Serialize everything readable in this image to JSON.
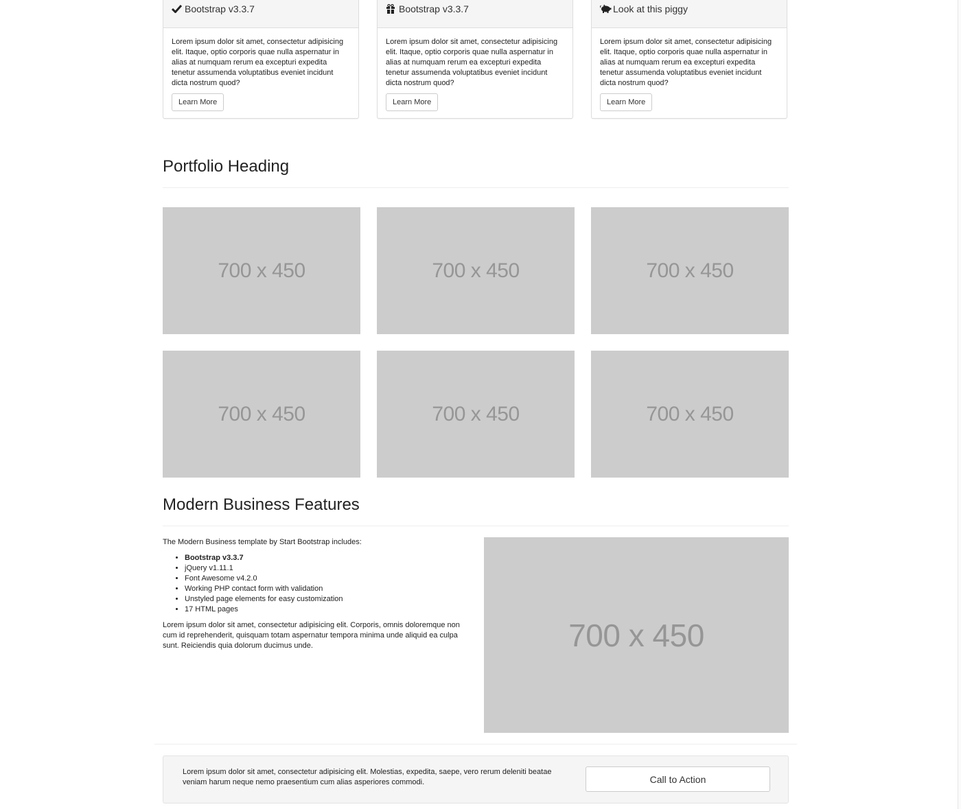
{
  "panels": [
    {
      "icon": "check-icon",
      "title": "Bootstrap v3.3.7",
      "text": "Lorem ipsum dolor sit amet, consectetur adipisicing elit. Itaque, optio corporis quae nulla aspernatur in alias at numquam rerum ea excepturi expedita tenetur assumenda voluptatibus eveniet incidunt dicta nostrum quod?",
      "button": "Learn More"
    },
    {
      "icon": "gift-icon",
      "title": "Bootstrap v3.3.7",
      "text": "Lorem ipsum dolor sit amet, consectetur adipisicing elit. Itaque, optio corporis quae nulla aspernatur in alias at numquam rerum ea excepturi expedita tenetur assumenda voluptatibus eveniet incidunt dicta nostrum quod?",
      "button": "Learn More"
    },
    {
      "icon": "piggy-bank-icon",
      "title": "Look at this piggy",
      "text": "Lorem ipsum dolor sit amet, consectetur adipisicing elit. Itaque, optio corporis quae nulla aspernatur in alias at numquam rerum ea excepturi expedita tenetur assumenda voluptatibus eveniet incidunt dicta nostrum quod?",
      "button": "Learn More"
    }
  ],
  "portfolio": {
    "heading": "Portfolio Heading",
    "items": [
      "700 x 450",
      "700 x 450",
      "700 x 450",
      "700 x 450",
      "700 x 450",
      "700 x 450"
    ]
  },
  "features": {
    "heading": "Modern Business Features",
    "intro": "The Modern Business template by Start Bootstrap includes:",
    "list": [
      "Bootstrap v3.3.7",
      "jQuery v1.11.1",
      "Font Awesome v4.2.0",
      "Working PHP contact form with validation",
      "Unstyled page elements for easy customization",
      "17 HTML pages"
    ],
    "paragraph": "Lorem ipsum dolor sit amet, consectetur adipisicing elit. Corporis, omnis doloremque non cum id reprehenderit, quisquam totam aspernatur tempora minima unde aliquid ea culpa sunt. Reiciendis quia dolorum ducimus unde.",
    "image": "700 x 450"
  },
  "cta": {
    "text": "Lorem ipsum dolor sit amet, consectetur adipisicing elit. Molestias, expedita, saepe, vero rerum deleniti beatae veniam harum neque nemo praesentium cum alias asperiores commodi.",
    "button": "Call to Action"
  }
}
